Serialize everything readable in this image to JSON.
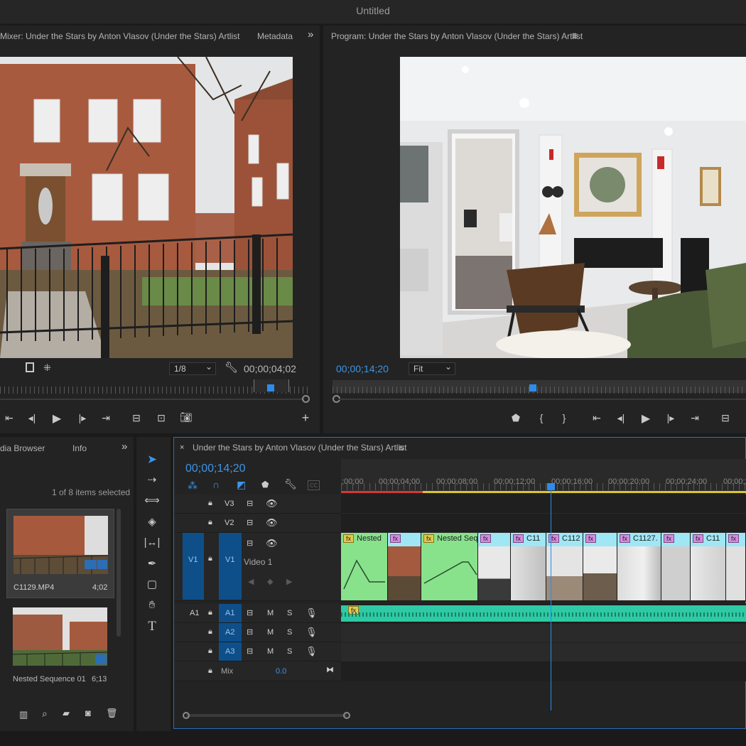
{
  "window": {
    "title": "Untitled"
  },
  "source_monitor": {
    "tab_title": "Mixer: Under the Stars by Anton Vlasov (Under the Stars) Artlist",
    "tab_metadata": "Metadata",
    "overflow_icon": "double-chevron-right-icon",
    "resolution": "1/8",
    "timecode": "00;00;04;02"
  },
  "program_monitor": {
    "tab_title": "Program: Under the Stars by Anton Vlasov (Under the Stars) Artlist",
    "menu_icon": "hamburger-icon",
    "timecode": "00;00;14;20",
    "fit": "Fit"
  },
  "project_panel": {
    "tab_media_browser": "dia Browser",
    "tab_info": "Info",
    "selection_status": "1 of 8 items selected",
    "items": [
      {
        "name": "C1129.MP4",
        "duration": "4;02",
        "selected": true
      },
      {
        "name": "Nested Sequence 01",
        "duration": "6;13",
        "selected": false
      }
    ]
  },
  "timeline": {
    "close_icon": "close-icon",
    "tab_title": "Under the Stars by Anton Vlasov (Under the Stars) Artlist",
    "timecode": "00;00;14;20",
    "ruler_labels": [
      ";00;00",
      "00;00;04;00",
      "00;00;08;00",
      "00;00;12;00",
      "00;00;16;00",
      "00;00;20;00",
      "00;00;24;00",
      "00;00;2"
    ],
    "tracks": {
      "v3": "V3",
      "v2": "V2",
      "v1_source": "V1",
      "v1": "V1",
      "video1": "Video 1",
      "a1_source": "A1",
      "a1": "A1",
      "a2": "A2",
      "a3": "A3",
      "mix": "Mix",
      "mix_value": "0.0",
      "mute": "M",
      "solo": "S"
    },
    "clips": [
      {
        "label": "Nested",
        "type": "nested"
      },
      {
        "label": "",
        "type": "video"
      },
      {
        "label": "Nested Seq",
        "type": "nested"
      },
      {
        "label": "",
        "type": "video"
      },
      {
        "label": "C11",
        "type": "video"
      },
      {
        "label": "C112",
        "type": "video"
      },
      {
        "label": "",
        "type": "video"
      },
      {
        "label": "C1127.",
        "type": "video"
      },
      {
        "label": "",
        "type": "video"
      },
      {
        "label": "C11",
        "type": "video"
      },
      {
        "label": "",
        "type": "video"
      }
    ]
  },
  "colors": {
    "accent": "#3d94e6",
    "nested_clip": "#88e28c",
    "video_clip": "#9fe7f5",
    "audio_clip": "#2dcaa4",
    "track_target": "#0e4f8a"
  }
}
